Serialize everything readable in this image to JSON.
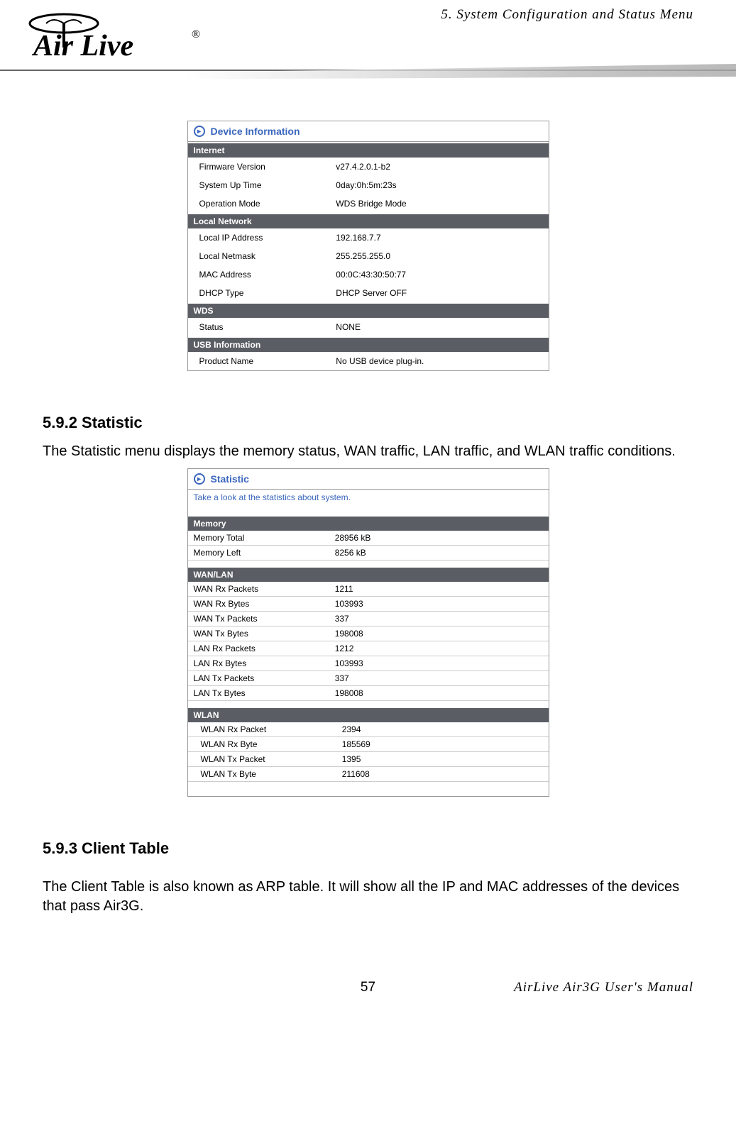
{
  "header": {
    "chapter": "5. System Configuration and Status Menu",
    "logo_text": "Air Live",
    "logo_reg": "®"
  },
  "device_info": {
    "title": "Device Information",
    "sections": [
      {
        "name": "Internet",
        "rows": [
          {
            "label": "Firmware Version",
            "value": "v27.4.2.0.1-b2"
          },
          {
            "label": "System Up Time",
            "value": "0day:0h:5m:23s"
          },
          {
            "label": "Operation Mode",
            "value": "WDS Bridge Mode"
          }
        ]
      },
      {
        "name": "Local Network",
        "rows": [
          {
            "label": "Local IP Address",
            "value": "192.168.7.7"
          },
          {
            "label": "Local Netmask",
            "value": "255.255.255.0"
          },
          {
            "label": "MAC Address",
            "value": "00:0C:43:30:50:77"
          },
          {
            "label": "DHCP Type",
            "value": "DHCP Server OFF"
          }
        ]
      },
      {
        "name": "WDS",
        "rows": [
          {
            "label": "Status",
            "value": "NONE"
          }
        ]
      },
      {
        "name": "USB Information",
        "rows": [
          {
            "label": "Product Name",
            "value": "No USB device plug-in."
          }
        ]
      }
    ]
  },
  "headings": {
    "h592": "5.9.2 Statistic",
    "p592": "The Statistic menu displays the memory status, WAN traffic, LAN traffic, and WLAN traffic conditions.",
    "h593": "5.9.3 Client Table",
    "p593": "The Client Table is also known as ARP table.   It will show all the IP and MAC addresses of the devices that pass Air3G."
  },
  "statistic": {
    "title": "Statistic",
    "sub": "Take a look at the statistics about system.",
    "sections": [
      {
        "name": "Memory",
        "rows": [
          {
            "label": "Memory Total",
            "value": "28956 kB"
          },
          {
            "label": "Memory Left",
            "value": "8256 kB"
          }
        ]
      },
      {
        "name": "WAN/LAN",
        "rows": [
          {
            "label": "WAN Rx Packets",
            "value": "1211"
          },
          {
            "label": "WAN Rx Bytes",
            "value": "103993"
          },
          {
            "label": "WAN Tx Packets",
            "value": "337"
          },
          {
            "label": "WAN Tx Bytes",
            "value": "198008"
          },
          {
            "label": "LAN Rx Packets",
            "value": "1212"
          },
          {
            "label": "LAN Rx Bytes",
            "value": "103993"
          },
          {
            "label": "LAN Tx Packets",
            "value": "337"
          },
          {
            "label": "LAN Tx Bytes",
            "value": "198008"
          }
        ]
      },
      {
        "name": "WLAN",
        "wlan": true,
        "rows": [
          {
            "label": "WLAN Rx Packet",
            "value": "2394"
          },
          {
            "label": "WLAN Rx Byte",
            "value": "185569"
          },
          {
            "label": "WLAN Tx Packet",
            "value": "1395"
          },
          {
            "label": "WLAN Tx Byte",
            "value": "211608"
          }
        ]
      }
    ]
  },
  "footer": {
    "page": "57",
    "manual": "AirLive Air3G User's Manual"
  }
}
